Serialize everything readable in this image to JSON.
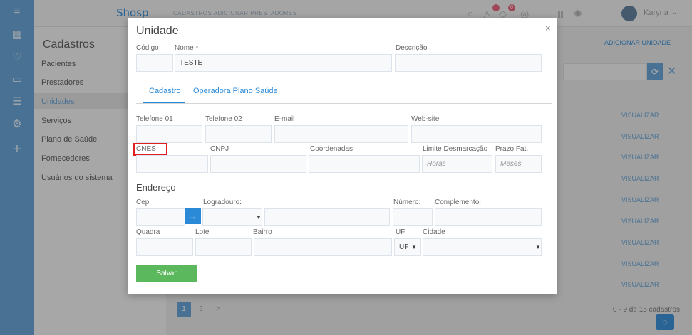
{
  "app": {
    "logo": "Shosp",
    "breadcrumb": "CADASTROS   ADICIONAR PRESTADORES",
    "user": "Karyna",
    "user_caret": "⌄",
    "notification_count": "0"
  },
  "sidebar": {
    "title": "Cadastros",
    "items": [
      "Pacientes",
      "Prestadores",
      "Unidades",
      "Serviços",
      "Plano de Saúde",
      "Fornecedores",
      "Usuários do sistema"
    ],
    "active_index": 2
  },
  "background": {
    "add_label": "ADICIONAR UNIDADE",
    "row_action": "VISUALIZAR",
    "pages": [
      "1",
      "2",
      ">"
    ],
    "count_label": "0 - 9 de 15 cadastros"
  },
  "modal": {
    "title": "Unidade",
    "close": "×",
    "codigo_label": "Código",
    "nome_label": "Nome *",
    "nome_value": "TESTE",
    "descricao_label": "Descrição",
    "tabs": [
      "Cadastro",
      "Operadora Plano Saúde"
    ],
    "telefone1_label": "Telefone 01",
    "telefone2_label": "Telefone 02",
    "email_label": "E-mail",
    "website_label": "Web-site",
    "cnes_label": "CNES",
    "cnpj_label": "CNPJ",
    "coordenadas_label": "Coordenadas",
    "limite_label": "Limite Desmarcação",
    "limite_placeholder": "Horas",
    "prazo_label": "Prazo Fat.",
    "prazo_placeholder": "Meses",
    "endereco_title": "Endereço",
    "cep_label": "Cep",
    "logradouro_label": "Logradouro:",
    "numero_label": "Número:",
    "complemento_label": "Complemento:",
    "quadra_label": "Quadra",
    "lote_label": "Lote",
    "bairro_label": "Bairro",
    "uf_label": "UF",
    "uf_value": "UF",
    "cidade_label": "Cidade",
    "save_label": "Salvar"
  }
}
